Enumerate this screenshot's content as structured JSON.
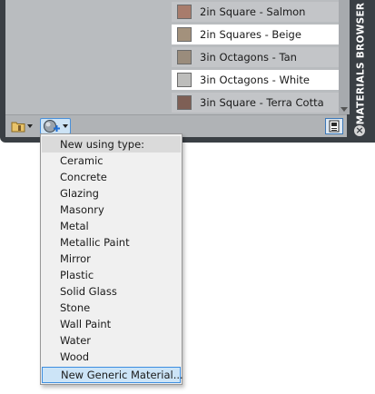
{
  "palette": {
    "title": "MATERIALS BROWSER",
    "materials": [
      {
        "label": "2in Square - Salmon",
        "swatch": "#a87c6c"
      },
      {
        "label": "2in Squares - Beige",
        "swatch": "#a3917c"
      },
      {
        "label": "3in Octagons - Tan",
        "swatch": "#9a8c7c"
      },
      {
        "label": "3in Octagons - White",
        "swatch": "#bdbdbb"
      },
      {
        "label": "3in Square - Terra Cotta",
        "swatch": "#7e5f55"
      }
    ]
  },
  "toolbar": {
    "folder_icon": "folder-icon",
    "create_material_icon": "create-material-icon",
    "view_icon": "panel-view-icon"
  },
  "menu": {
    "header": "New using type:",
    "items": [
      "Ceramic",
      "Concrete",
      "Glazing",
      "Masonry",
      "Metal",
      "Metallic Paint",
      "Mirror",
      "Plastic",
      "Solid Glass",
      "Stone",
      "Wall Paint",
      "Water",
      "Wood"
    ],
    "footer": "New Generic Material...",
    "highlight_color": "#cce4f7"
  }
}
